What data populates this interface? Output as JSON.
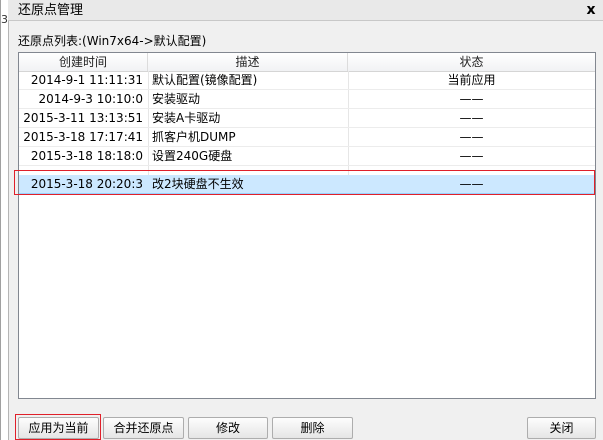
{
  "window": {
    "title": "还原点管理",
    "close_glyph": "x",
    "left_edge_mark": "3"
  },
  "list": {
    "caption": "还原点列表:(Win7x64->默认配置)",
    "columns": [
      "创建时间",
      "描述",
      "状态"
    ],
    "rows": [
      {
        "time": "2014-9-1 11:11:31",
        "desc": "默认配置(镜像配置)",
        "status": "当前应用"
      },
      {
        "time": "2014-9-3 10:10:0",
        "desc": "安装驱动",
        "status": "——"
      },
      {
        "time": "2015-3-11 13:13:51",
        "desc": "安装A卡驱动",
        "status": "——"
      },
      {
        "time": "2015-3-18 17:17:41",
        "desc": "抓客户机DUMP",
        "status": "——"
      },
      {
        "time": "2015-3-18 18:18:0",
        "desc": "设置240G硬盘",
        "status": "——"
      },
      {
        "time": "2015-3-18 20:20:3",
        "desc": "改2块硬盘不生效",
        "status": "——"
      }
    ],
    "selected_index": 5
  },
  "buttons": {
    "apply": "应用为当前",
    "merge": "合并还原点",
    "edit": "修改",
    "delete": "删除",
    "close": "关闭"
  },
  "colors": {
    "selection": "#cce8ff",
    "annotation_red": "#e0202a"
  }
}
